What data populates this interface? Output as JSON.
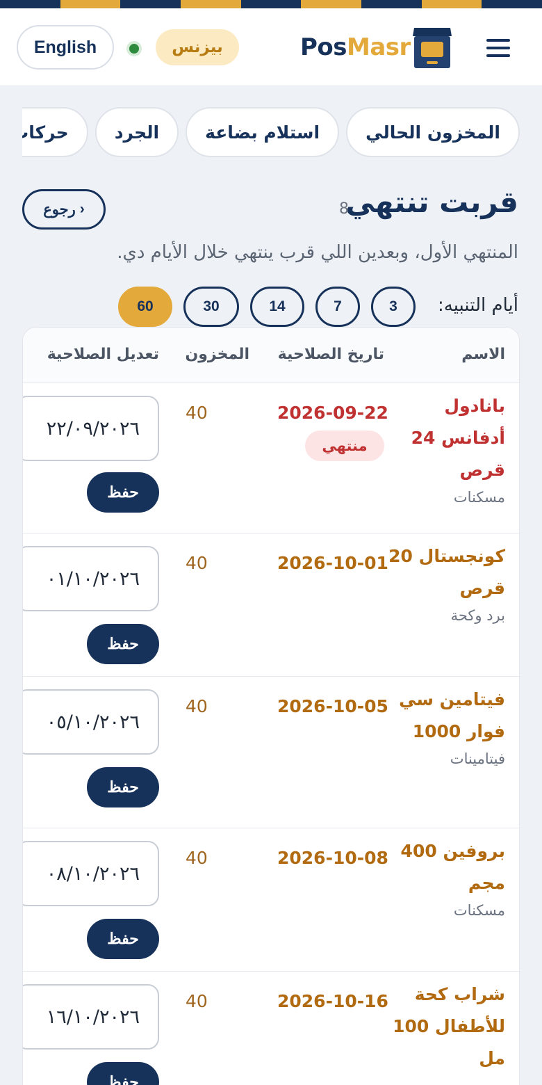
{
  "header": {
    "language_button": "English",
    "plan_badge": "بيزنس",
    "brand_part1": "Pos",
    "brand_part2": "Masr"
  },
  "tabs": [
    "المخزون الحالي",
    "استلام بضاعة",
    "الجرد",
    "حركات المخزون"
  ],
  "page": {
    "title": "قربت تنتهي",
    "count": "8",
    "back_label": "رجوع",
    "subtitle": "المنتهي الأول، وبعدين اللي قرب ينتهي خلال الأيام دي.",
    "alert_days_label": "أيام التنبيه:",
    "alert_days": [
      "3",
      "7",
      "14",
      "30",
      "60"
    ],
    "alert_days_selected": "60"
  },
  "table": {
    "headers": {
      "name": "الاسم",
      "expiry": "تاريخ الصلاحية",
      "stock": "المخزون",
      "edit": "تعديل الصلاحية"
    },
    "save_label": "حفظ",
    "rows": [
      {
        "name": "بانادول أدفانس 24 قرص",
        "category": "مسكنات",
        "expiry": "2026-09-22",
        "badge": "منتهي",
        "stock": "40",
        "input_value": "٢٢/٠٩/٢٠٢٦",
        "status_color": "#c03131"
      },
      {
        "name": "كونجستال 20 قرص",
        "category": "برد وكحة",
        "expiry": "2026-10-01",
        "badge": "",
        "stock": "40",
        "input_value": "٠١/١٠/٢٠٢٦",
        "status_color": "#b26a10"
      },
      {
        "name": "فيتامين سي فوار 1000",
        "category": "فيتامينات",
        "expiry": "2026-10-05",
        "badge": "",
        "stock": "40",
        "input_value": "٠٥/١٠/٢٠٢٦",
        "status_color": "#b26a10"
      },
      {
        "name": "بروفين 400 مجم",
        "category": "مسكنات",
        "expiry": "2026-10-08",
        "badge": "",
        "stock": "40",
        "input_value": "٠٨/١٠/٢٠٢٦",
        "status_color": "#b26a10"
      },
      {
        "name": "شراب كحة للأطفال 100 مل",
        "category": "",
        "expiry": "2026-10-16",
        "badge": "",
        "stock": "40",
        "input_value": "١٦/١٠/٢٠٢٦",
        "status_color": "#b26a10"
      }
    ]
  },
  "colors": {
    "navy": "#17325a",
    "gold": "#e3a93b",
    "expired_red": "#c03131",
    "warning_amber": "#b26a10"
  }
}
